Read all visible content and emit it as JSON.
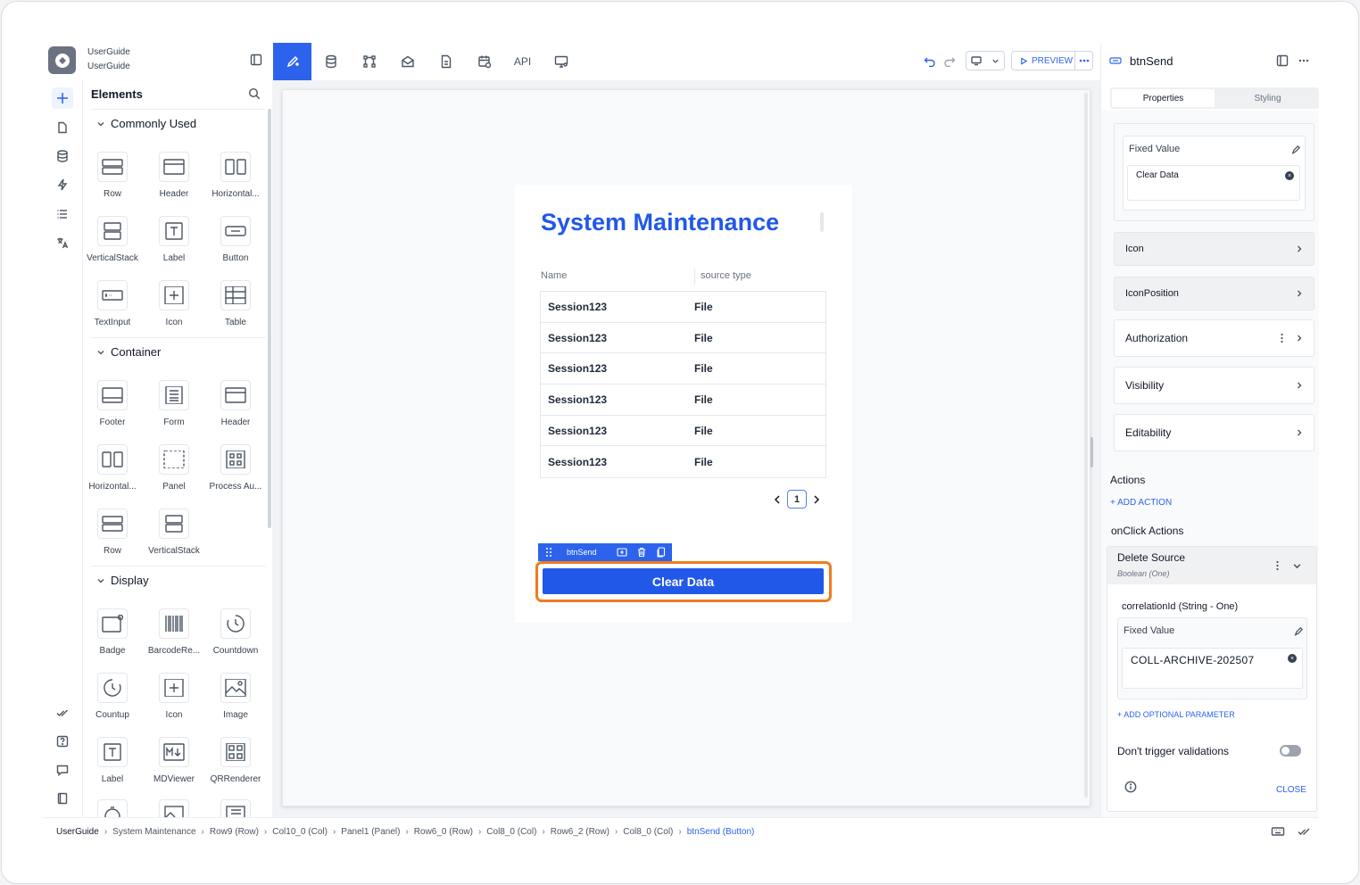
{
  "project": {
    "name": "UserGuide",
    "subname": "UserGuide"
  },
  "elements_panel": {
    "title": "Elements",
    "sections": [
      {
        "title": "Commonly Used",
        "items": [
          "Row",
          "Header",
          "Horizontal...",
          "VerticalStack",
          "Label",
          "Button",
          "TextInput",
          "Icon",
          "Table"
        ]
      },
      {
        "title": "Container",
        "items": [
          "Footer",
          "Form",
          "Header",
          "Horizontal...",
          "Panel",
          "Process Au...",
          "Row",
          "VerticalStack"
        ]
      },
      {
        "title": "Display",
        "items": [
          "Badge",
          "BarcodeRe...",
          "Countdown",
          "Countup",
          "Icon",
          "Image",
          "Label",
          "MDViewer",
          "QRRenderer"
        ]
      }
    ]
  },
  "toolbar": {
    "api_label": "API",
    "preview_label": "PREVIEW"
  },
  "canvas": {
    "title": "System Maintenance",
    "columns": [
      "Name",
      "source type"
    ],
    "rows": [
      [
        "Session123",
        "File"
      ],
      [
        "Session123",
        "File"
      ],
      [
        "Session123",
        "File"
      ],
      [
        "Session123",
        "File"
      ],
      [
        "Session123",
        "File"
      ],
      [
        "Session123",
        "File"
      ]
    ],
    "page": "1",
    "selected_label": "btnSend",
    "button_label": "Clear Data"
  },
  "props_panel": {
    "title": "btnSend",
    "tabs": [
      "Properties",
      "Styling"
    ],
    "fixed_value_label": "Fixed Value",
    "fixed_value": "Clear Data",
    "groups": {
      "icon": "Icon",
      "icon_position": "IconPosition",
      "authorization": "Authorization",
      "visibility": "Visibility",
      "editability": "Editability"
    },
    "actions_label": "Actions",
    "add_action": "+ ADD ACTION",
    "onclick_label": "onClick Actions",
    "action": {
      "name": "Delete Source",
      "type": "Boolean (One)",
      "param_label": "correlationId (String - One)",
      "param_fixed_label": "Fixed Value",
      "param_value": "COLL-ARCHIVE-202507",
      "add_param": "+ ADD OPTIONAL PARAMETER",
      "toggle_label": "Don't trigger validations",
      "close": "CLOSE"
    }
  },
  "breadcrumb": [
    "UserGuide",
    "System Maintenance",
    "Row9 (Row)",
    "Col10_0 (Col)",
    "Panel1 (Panel)",
    "Row6_0 (Row)",
    "Col8_0 (Col)",
    "Row6_2 (Row)",
    "Col8_0 (Col)",
    "btnSend (Button)"
  ],
  "colors": {
    "accent": "#2d63ec",
    "title": "#2158e8",
    "highlight": "#f07b1d"
  }
}
